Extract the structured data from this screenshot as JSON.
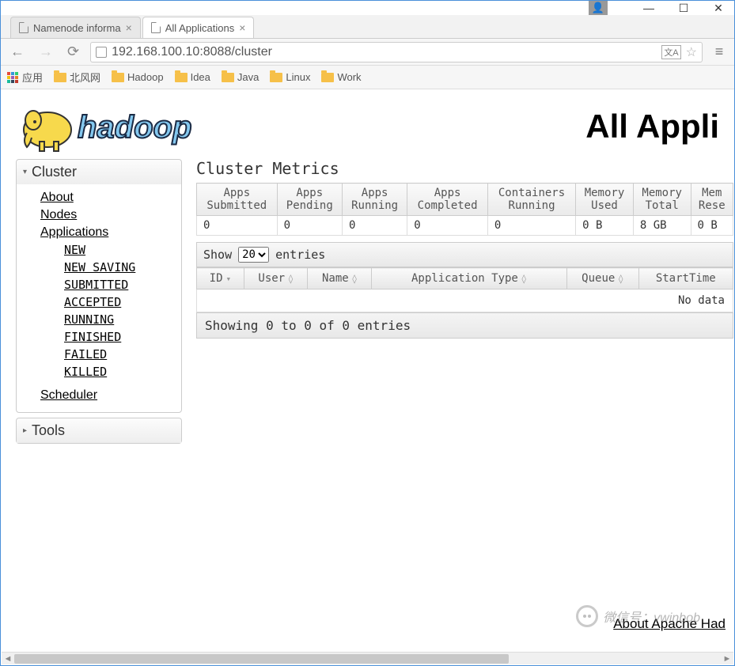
{
  "window": {
    "minimize": "—",
    "maximize": "☐",
    "close": "✕"
  },
  "tabs": [
    {
      "label": "Namenode informa",
      "active": false
    },
    {
      "label": "All Applications",
      "active": true
    }
  ],
  "url": "192.168.100.10:8088/cluster",
  "bookmarks": {
    "apps": "应用",
    "folders": [
      "北风网",
      "Hadoop",
      "Idea",
      "Java",
      "Linux",
      "Work"
    ]
  },
  "page_title": "All Appli",
  "sidebar": {
    "cluster": {
      "header": "Cluster",
      "links": [
        "About",
        "Nodes",
        "Applications"
      ],
      "states": [
        "NEW",
        "NEW SAVING",
        "SUBMITTED",
        "ACCEPTED",
        "RUNNING",
        "FINISHED",
        "FAILED",
        "KILLED"
      ],
      "scheduler": "Scheduler"
    },
    "tools": {
      "header": "Tools"
    }
  },
  "metrics": {
    "title": "Cluster Metrics",
    "headers": [
      "Apps Submitted",
      "Apps Pending",
      "Apps Running",
      "Apps Completed",
      "Containers Running",
      "Memory Used",
      "Memory Total",
      "Mem Rese"
    ],
    "row": [
      "0",
      "0",
      "0",
      "0",
      "0",
      "0 B",
      "8 GB",
      "0 B"
    ]
  },
  "datatable": {
    "show_label": "Show",
    "entries_label": "entries",
    "length_value": "20",
    "headers": [
      "ID",
      "User",
      "Name",
      "Application Type",
      "Queue",
      "StartTime"
    ],
    "empty": "No data",
    "info": "Showing 0 to 0 of 0 entries"
  },
  "footer": "About Apache Had",
  "watermark": "微信号：vwinbob"
}
